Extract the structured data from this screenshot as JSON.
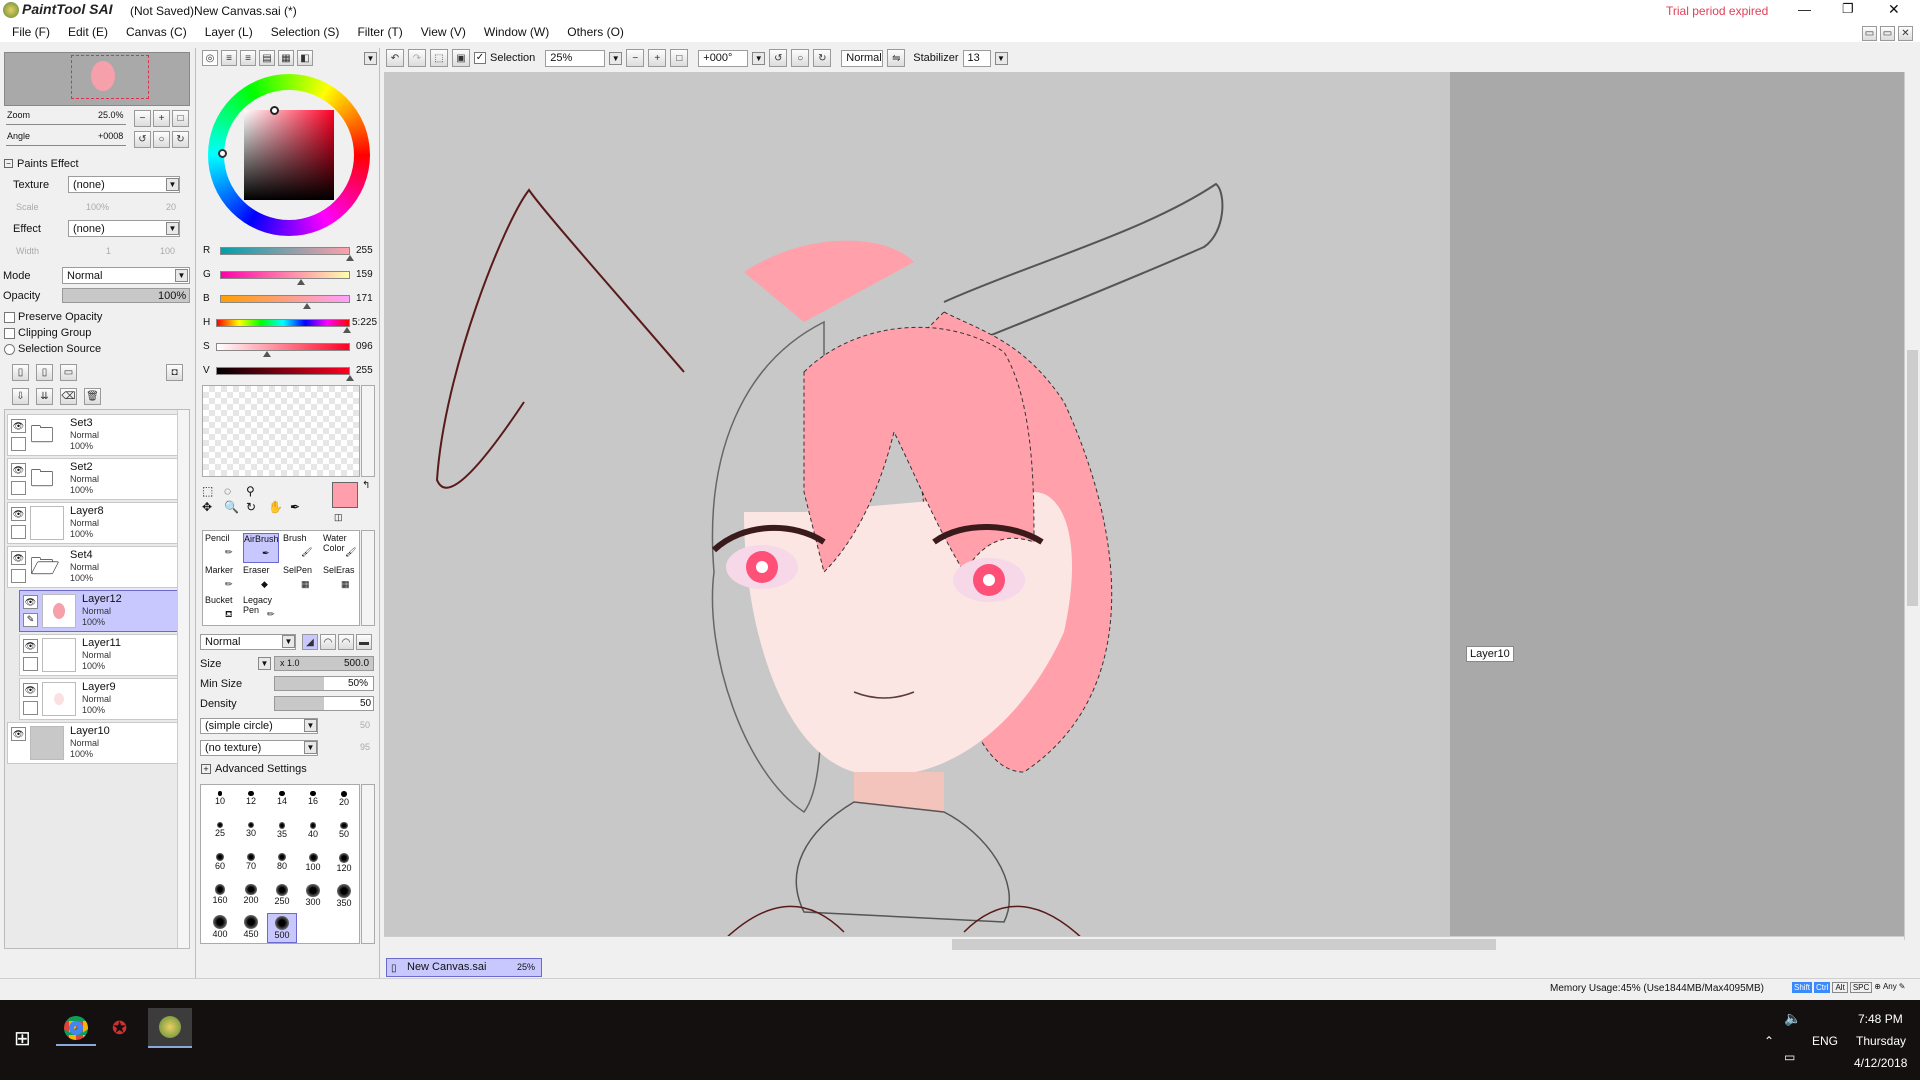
{
  "app": {
    "logo": "PaintTool SAI",
    "title": "(Not Saved)New Canvas.sai (*)",
    "trial": "Trial period expired",
    "min": "—",
    "max": "❐",
    "close": "✕"
  },
  "menu": [
    "File (F)",
    "Edit (E)",
    "Canvas (C)",
    "Layer (L)",
    "Selection (S)",
    "Filter (T)",
    "View (V)",
    "Window (W)",
    "Others (O)"
  ],
  "nav": {
    "zoom_label": "Zoom",
    "zoom_value": "25.0%",
    "angle_label": "Angle",
    "angle_value": "+0008"
  },
  "paints_effect": {
    "header": "Paints Effect",
    "texture_label": "Texture",
    "texture_value": "(none)",
    "scale_label": "Scale",
    "scale_value": "100%",
    "scale_num": "20",
    "effect_label": "Effect",
    "effect_value": "(none)",
    "width_label": "Width",
    "width_value": "1",
    "width_num": "100"
  },
  "layer_props": {
    "mode_label": "Mode",
    "mode_value": "Normal",
    "opacity_label": "Opacity",
    "opacity_value": "100%",
    "preserve": "Preserve Opacity",
    "clipping": "Clipping Group",
    "selsource": "Selection Source"
  },
  "layers": [
    {
      "name": "Set3",
      "mode": "Normal",
      "opacity": "100%",
      "folder": true
    },
    {
      "name": "Set2",
      "mode": "Normal",
      "opacity": "100%",
      "folder": true
    },
    {
      "name": "Layer8",
      "mode": "Normal",
      "opacity": "100%",
      "folder": false
    },
    {
      "name": "Set4",
      "mode": "Normal",
      "opacity": "100%",
      "folder": true
    },
    {
      "name": "Layer12",
      "mode": "Normal",
      "opacity": "100%",
      "folder": false
    },
    {
      "name": "Layer11",
      "mode": "Normal",
      "opacity": "100%",
      "folder": false
    },
    {
      "name": "Layer9",
      "mode": "Normal",
      "opacity": "100%",
      "folder": false
    },
    {
      "name": "Layer10",
      "mode": "Normal",
      "opacity": "100%",
      "folder": false
    }
  ],
  "color": {
    "r_label": "R",
    "r": "255",
    "g_label": "G",
    "g": "159",
    "b_label": "B",
    "b": "171",
    "h_label": "H",
    "h": "5:225",
    "s_label": "S",
    "s": "096",
    "v_label": "V",
    "v": "255",
    "fg": "#ff9fab",
    "bg": "#ffffff",
    "r_frac": 1.0,
    "g_frac": 0.62,
    "b_frac": 0.67,
    "h_frac": 0.98,
    "s_frac": 0.38,
    "v_frac": 1.0
  },
  "tools": [
    {
      "name": "Pencil"
    },
    {
      "name": "AirBrush"
    },
    {
      "name": "Brush"
    },
    {
      "name": "Water Color"
    },
    {
      "name": "Marker"
    },
    {
      "name": "Eraser"
    },
    {
      "name": "SelPen"
    },
    {
      "name": "SelEras"
    },
    {
      "name": "Bucket"
    },
    {
      "name": "Legacy Pen"
    }
  ],
  "brush": {
    "mode": "Normal",
    "size_label": "Size",
    "size_mult": "x 1.0",
    "size_value": "500.0",
    "minsize_label": "Min Size",
    "minsize_value": "50%",
    "density_label": "Density",
    "density_value": "50",
    "shape": "(simple circle)",
    "shape_num": "50",
    "texture": "(no texture)",
    "texture_num": "95",
    "advanced": "Advanced Settings",
    "minsize_frac": 0.5,
    "density_frac": 0.5
  },
  "brush_sizes": [
    "10",
    "12",
    "14",
    "16",
    "20",
    "25",
    "30",
    "35",
    "40",
    "50",
    "60",
    "70",
    "80",
    "100",
    "120",
    "160",
    "200",
    "250",
    "300",
    "350",
    "400",
    "450",
    "500"
  ],
  "toolbar": {
    "selection_label": "Selection",
    "zoom": "25%",
    "angle": "+000°",
    "blend": "Normal",
    "stabilizer_label": "Stabilizer",
    "stabilizer": "13"
  },
  "canvas": {
    "tooltip": "Layer10"
  },
  "tab": {
    "name": "New Canvas.sai",
    "zoom": "25%"
  },
  "status": {
    "memory": "Memory Usage:45% (Use1844MB/Max4095MB)",
    "keys": [
      "Shift",
      "Ctrl",
      "Alt",
      "SPC"
    ],
    "any": "Any"
  },
  "taskbar": {
    "time": "7:48 PM",
    "day": "Thursday",
    "date": "4/12/2018",
    "lang": "ENG"
  }
}
